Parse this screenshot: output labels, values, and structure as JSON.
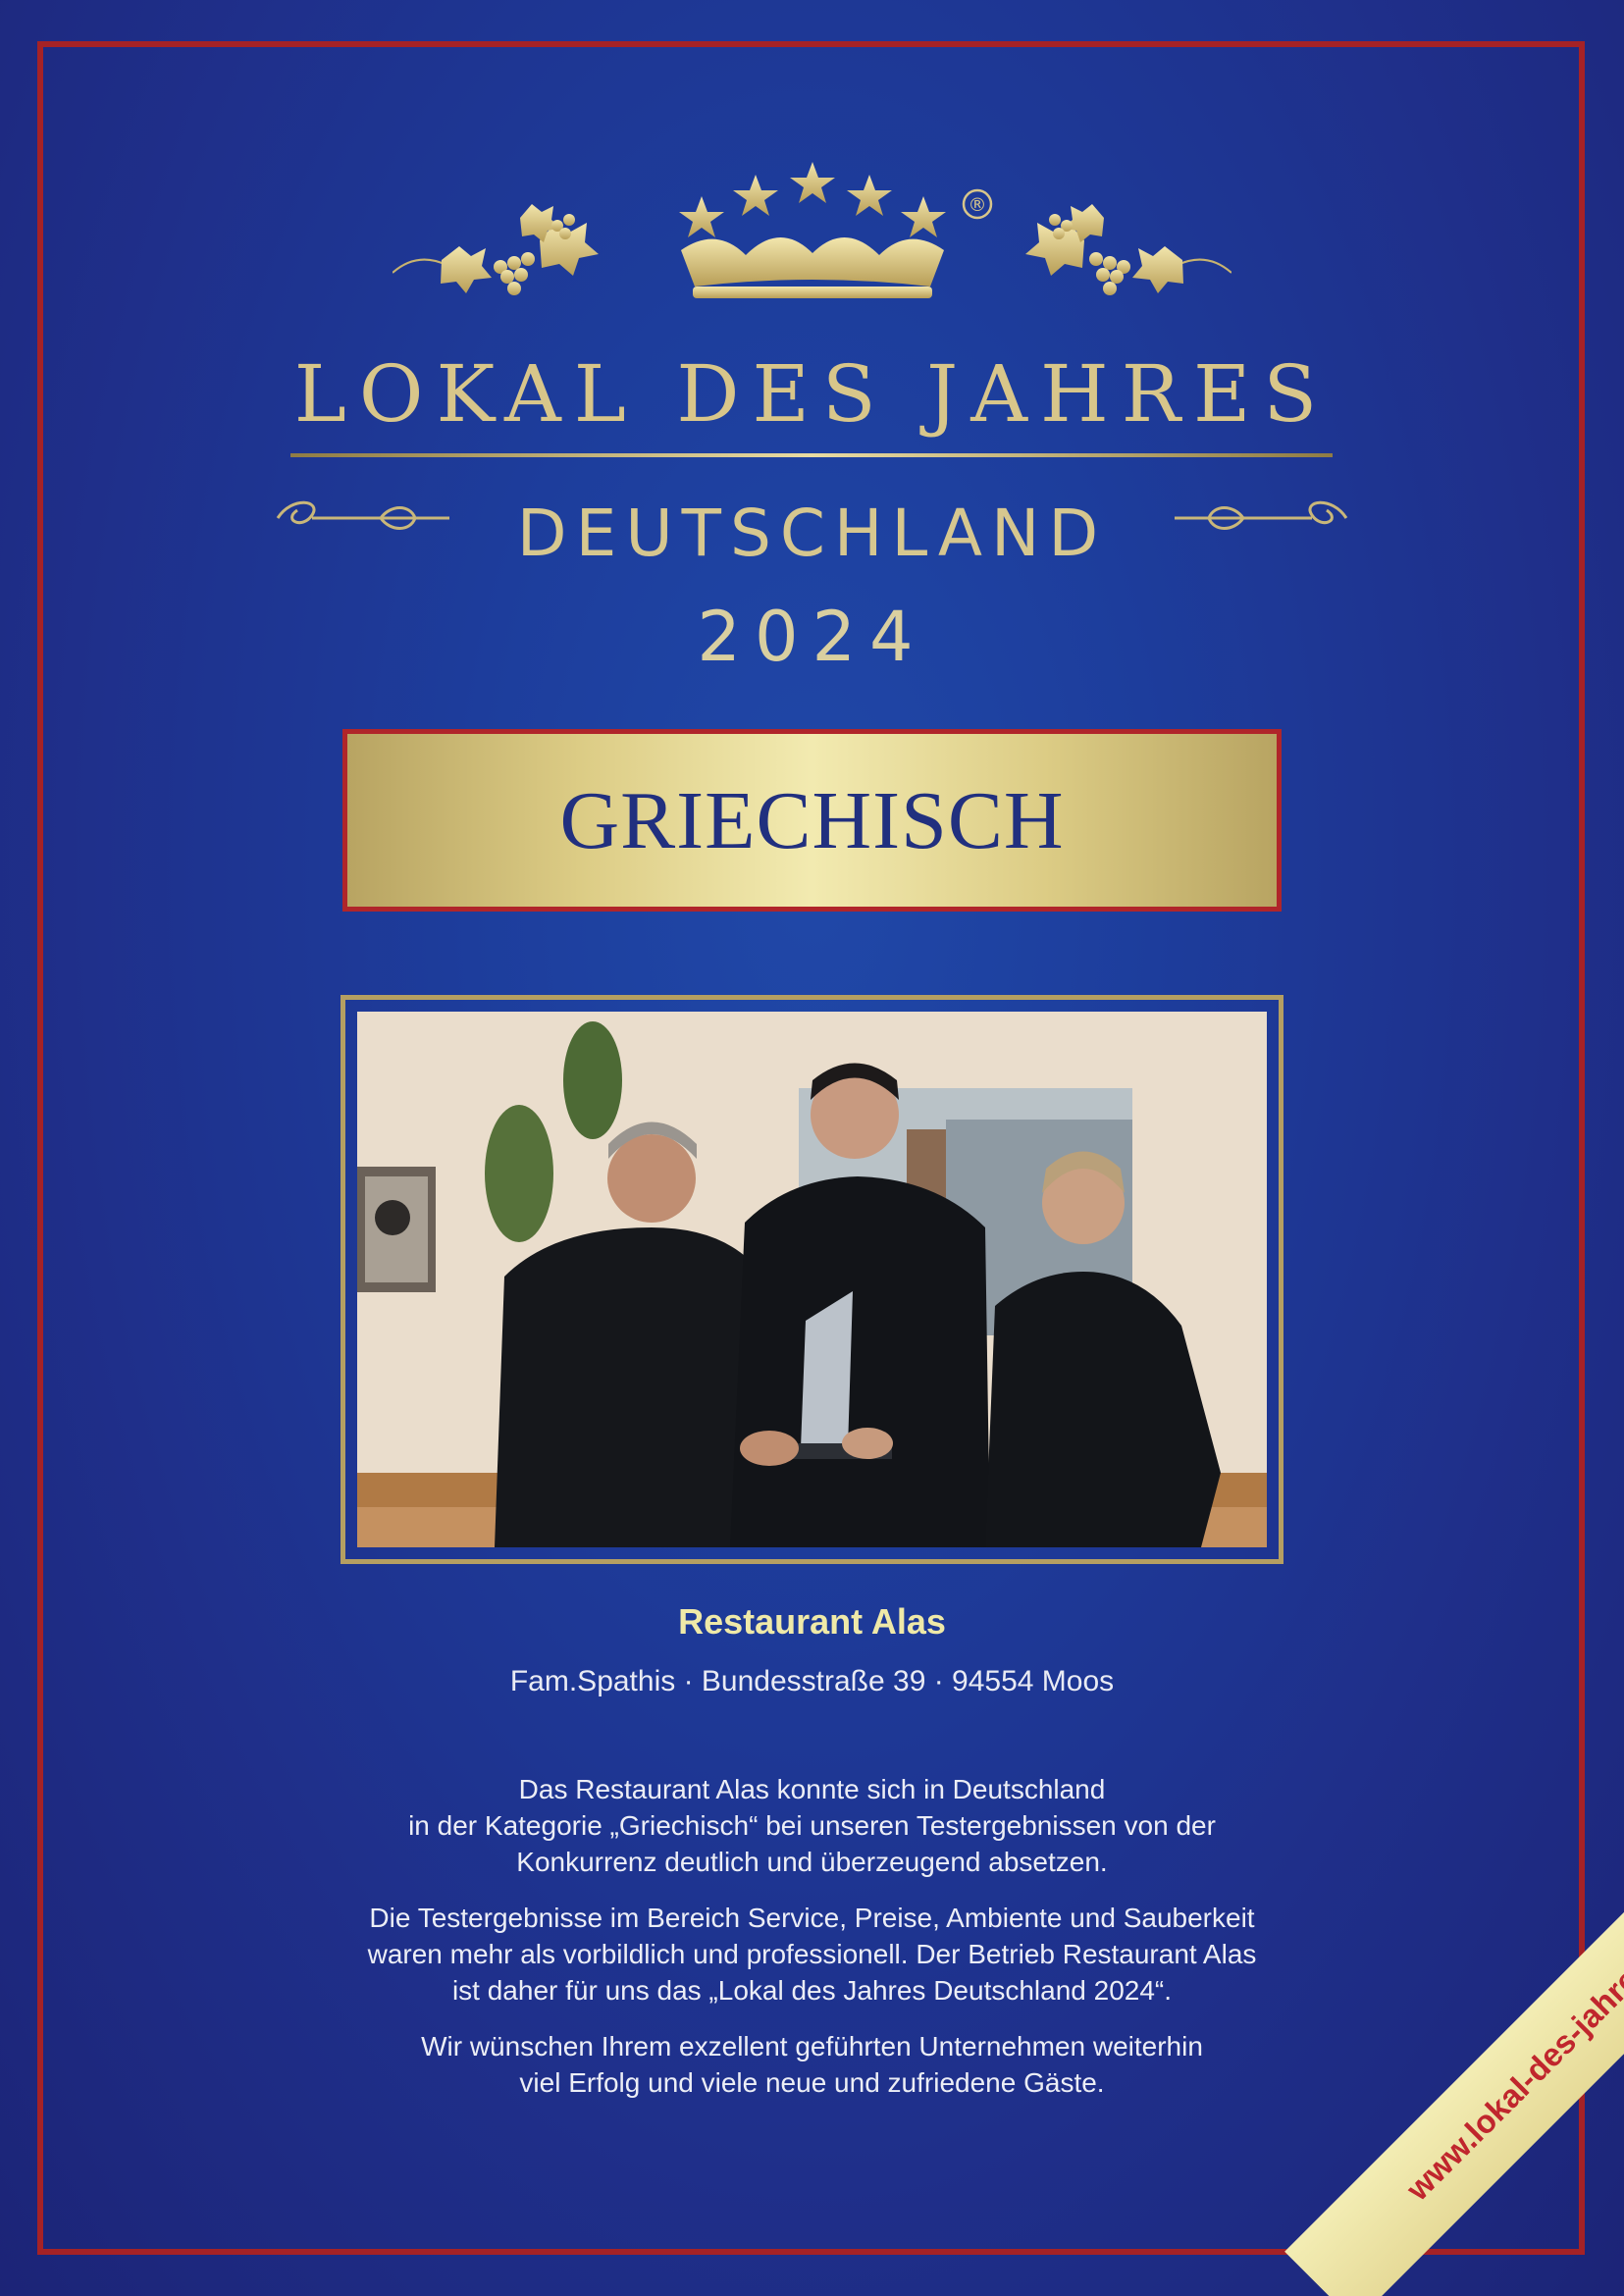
{
  "header": {
    "title": "LOKAL DES JAHRES",
    "country": "DEUTSCHLAND",
    "year": "2024",
    "registered_mark": "®"
  },
  "category": {
    "label": "GRIECHISCH"
  },
  "restaurant": {
    "name": "Restaurant Alas",
    "address": "Fam.Spathis · Bundesstraße 39 · 94554 Moos"
  },
  "body": {
    "paragraph1": [
      "Das Restaurant Alas konnte sich in Deutschland",
      "in der Kategorie „Griechisch“ bei unseren Testergebnissen von der",
      "Konkurrenz deutlich und überzeugend absetzen."
    ],
    "paragraph2": [
      "Die Testergebnisse im Bereich Service, Preise, Ambiente und Sauberkeit",
      "waren mehr als vorbildlich und professionell. Der Betrieb Restaurant Alas",
      "ist daher für uns das „Lokal des Jahres Deutschland 2024“."
    ],
    "paragraph3": [
      "Wir wünschen Ihrem exzellent geführten Unternehmen weiterhin",
      "viel Erfolg und viele neue und zufriedene Gäste."
    ]
  },
  "ribbon": {
    "url": "www.lokal-des-jahres.de"
  },
  "colors": {
    "background": "#1f3592",
    "frame_red": "#a52226",
    "gold": "#d8c68a",
    "category_text": "#21307f",
    "ribbon_text": "#c0262d"
  },
  "icons": [
    "crown-icon",
    "star-icon",
    "grapevine-icon",
    "flourish-icon"
  ]
}
